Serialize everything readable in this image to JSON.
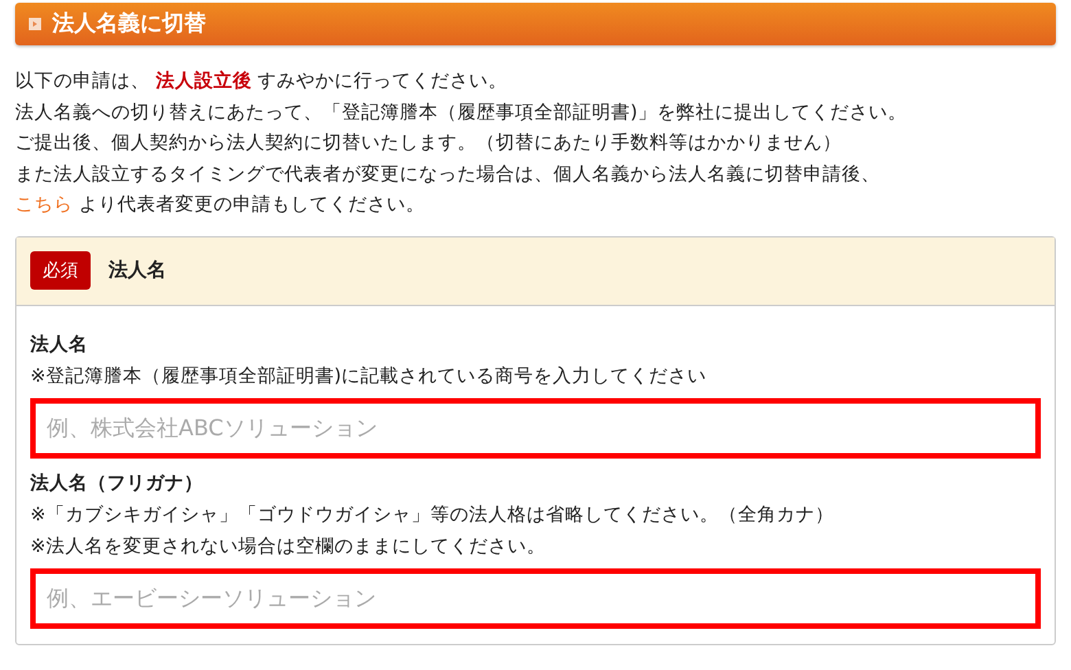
{
  "section": {
    "title": "法人名義に切替"
  },
  "intro": {
    "lines": [
      "以下の申請は、 **法人設立後** すみやかに行ってください。",
      "法人名義への切り替えにあたって、「登記簿謄本（履歴事項全部証明書)」を弊社に提出してください。",
      "ご提出後、個人契約から法人契約に切替いたします。（切替にあたり手数料等はかかりません）",
      "また法人設立するタイミングで代表者が変更になった場合は、個人名義から法人名義に切替申請後、"
    ],
    "last_line": {
      "link": "こちら",
      "text": " より代表者変更の申請もしてください。"
    }
  },
  "card": {
    "badge": "必須",
    "title": "法人名",
    "fields": [
      {
        "label": "法人名",
        "notes": [
          "※登記簿謄本（履歴事項全部証明書)に記載されている商号を入力してください"
        ],
        "placeholder": "例、株式会社ABCソリューション",
        "error": true
      },
      {
        "label": "法人名（フリガナ）",
        "notes": [
          "※「カブシキガイシャ」「ゴウドウガイシャ」等の法人格は省略してください。（全角カナ）",
          "※法人名を変更されない場合は空欄のままにしてください。"
        ],
        "placeholder": "例、エービーシーソリューション",
        "error": true
      }
    ]
  }
}
